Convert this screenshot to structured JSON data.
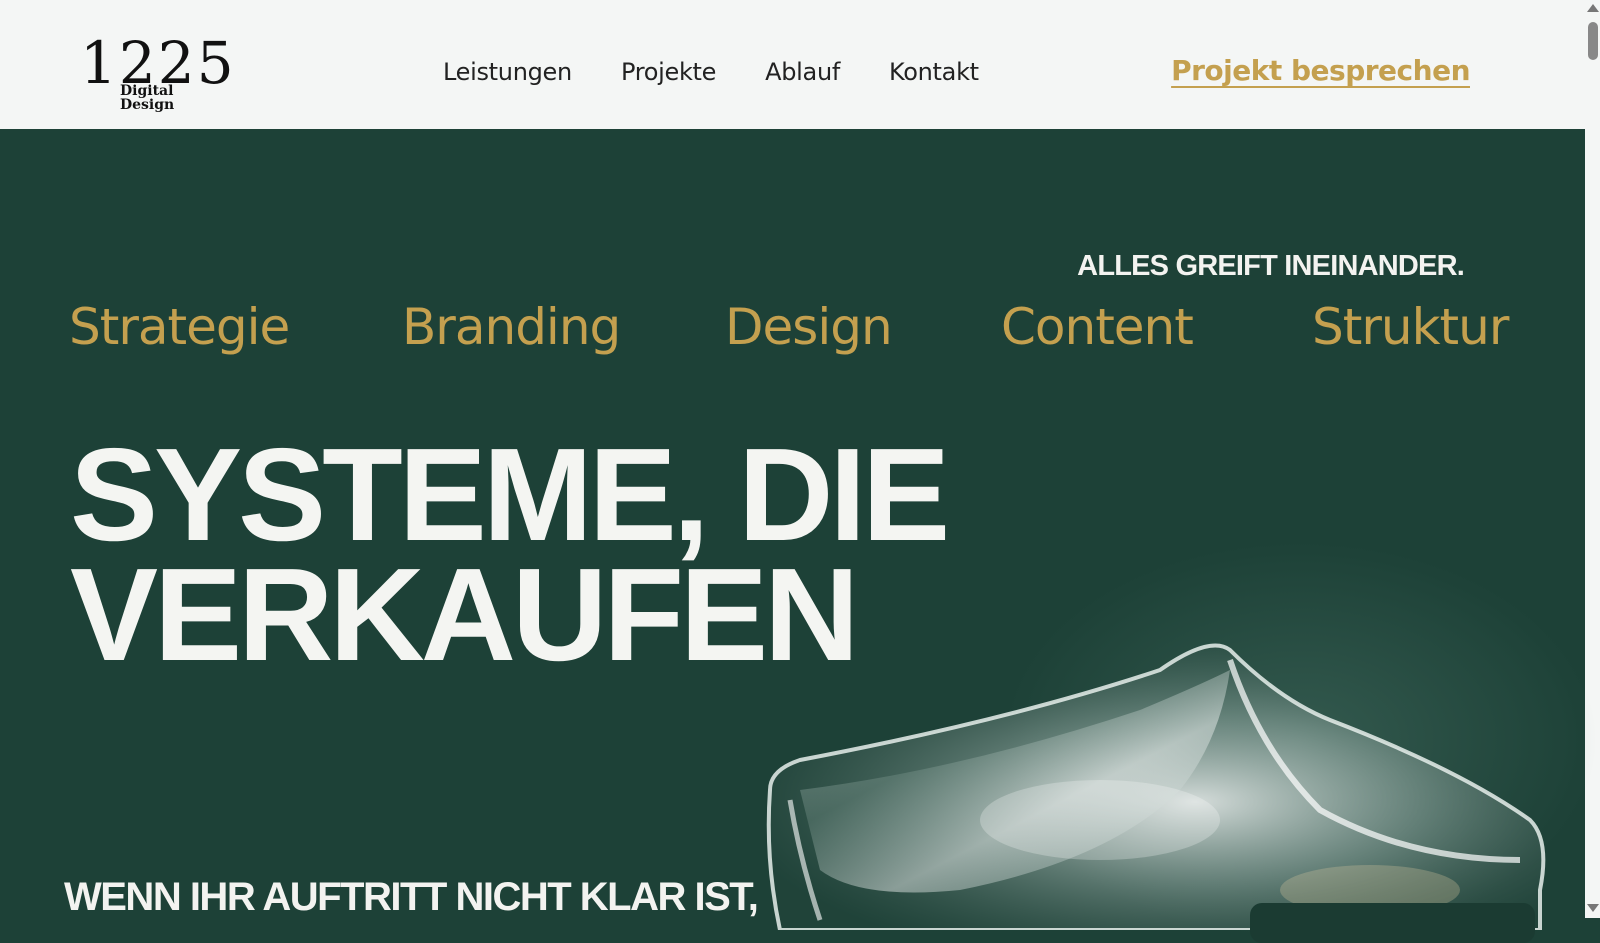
{
  "header": {
    "logo": {
      "number": "1225",
      "subtitle": "Digital Design"
    },
    "nav": [
      "Leistungen",
      "Projekte",
      "Ablauf",
      "Kontakt"
    ],
    "cta_label": "Projekt besprechen"
  },
  "hero": {
    "tagline": "ALLES GREIFT INEINANDER.",
    "services": [
      "Strategie",
      "Branding",
      "Design",
      "Content",
      "Struktur"
    ],
    "title_line1": "SYSTEME, DIE",
    "title_line2": "VERKAUFEN",
    "subheading": "WENN IHR AUFTRITT NICHT KLAR IST,"
  },
  "colors": {
    "hero_bg": "#1d4137",
    "header_bg": "#f4f6f5",
    "accent_gold": "#c4a04f",
    "text_light": "#f4f5f2"
  },
  "icons": [
    "scroll-up-arrow-icon",
    "scroll-down-arrow-icon"
  ]
}
